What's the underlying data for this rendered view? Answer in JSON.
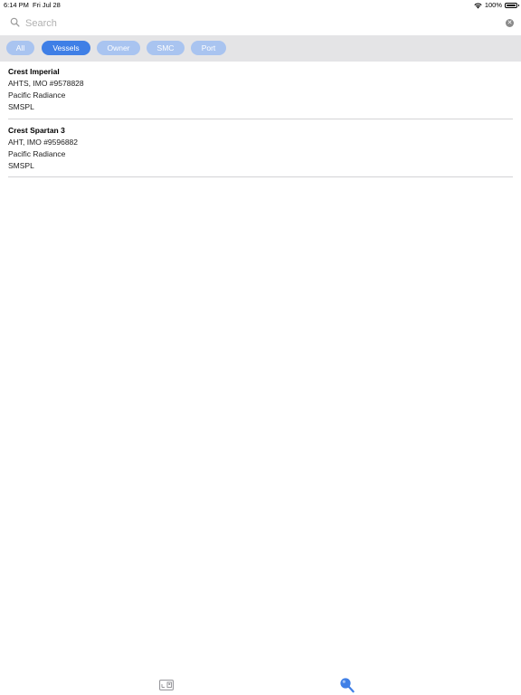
{
  "status_bar": {
    "time": "6:14 PM",
    "date": "Fri Jul 28",
    "battery": "100%"
  },
  "search": {
    "placeholder": "Search",
    "value": ""
  },
  "filters": [
    {
      "label": "All",
      "active": false
    },
    {
      "label": "Vessels",
      "active": true
    },
    {
      "label": "Owner",
      "active": false
    },
    {
      "label": "SMC",
      "active": false
    },
    {
      "label": "Port",
      "active": false
    }
  ],
  "results": [
    {
      "name": "Crest Imperial",
      "type_imo": "AHTS, IMO #9578828",
      "owner": "Pacific Radiance",
      "manager": "SMSPL"
    },
    {
      "name": "Crest Spartan 3",
      "type_imo": "AHT, IMO #9596882",
      "owner": "Pacific Radiance",
      "manager": "SMSPL"
    }
  ],
  "tab_bar": {
    "tabs": [
      {
        "icon": "id-card-icon",
        "active": false
      },
      {
        "icon": "search-icon",
        "active": true
      }
    ]
  },
  "colors": {
    "accent": "#3f7fe6",
    "chip_inactive": "#a9c4f0",
    "filter_bar_bg": "#e4e4e6",
    "divider": "#d3d3d6"
  }
}
